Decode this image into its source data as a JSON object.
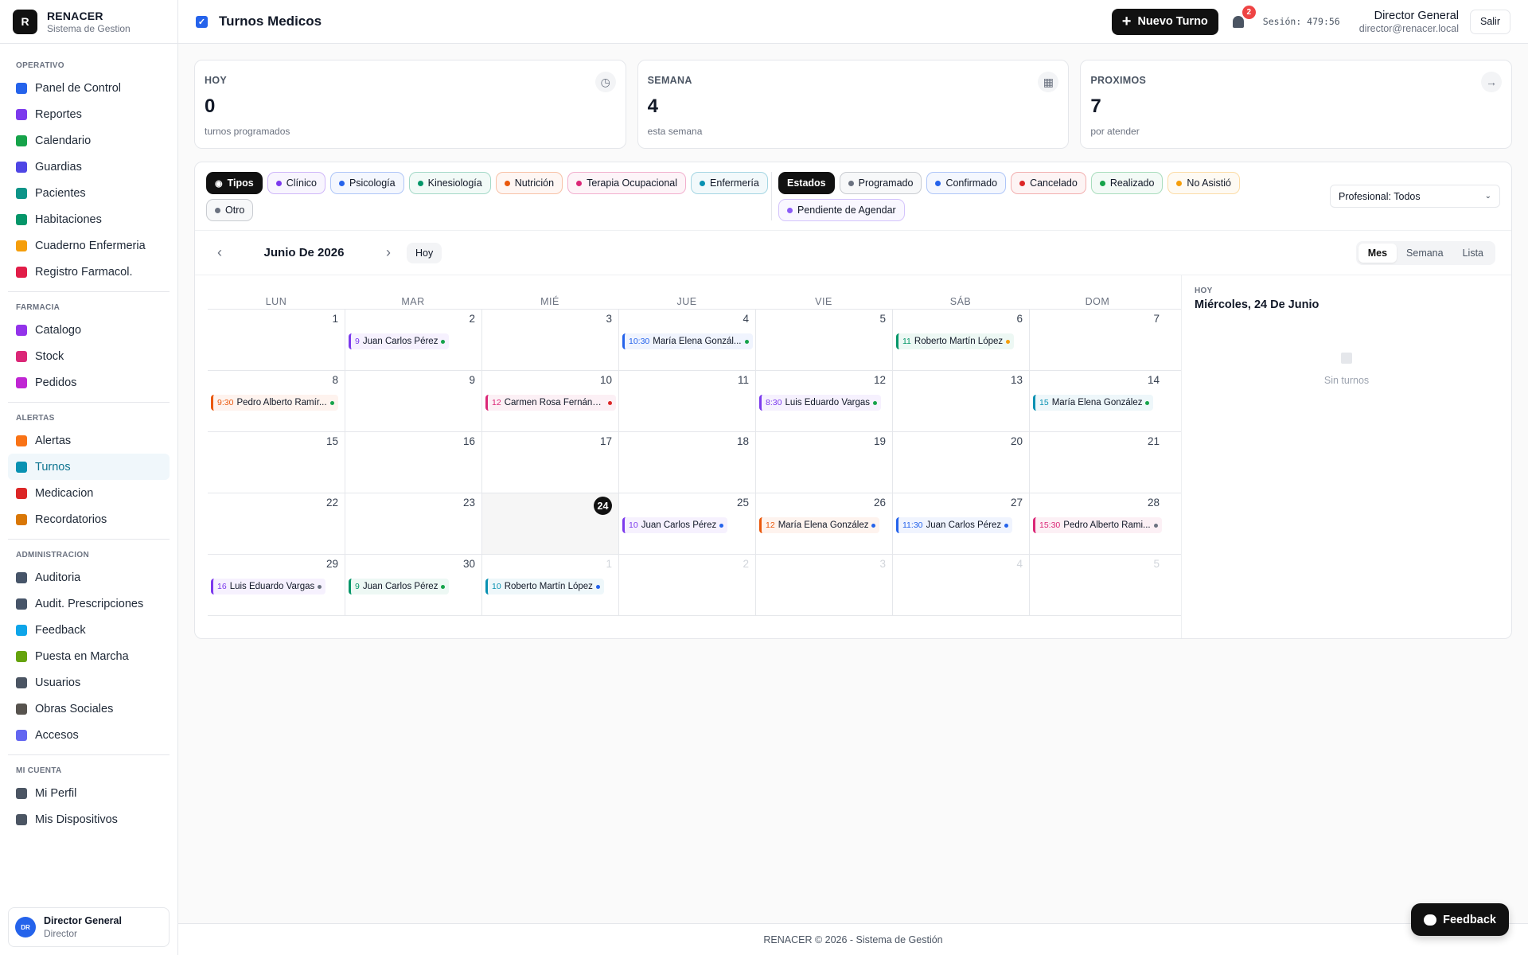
{
  "brand": {
    "logo_letter": "R",
    "title": "RENACER",
    "subtitle": "Sistema de Gestion"
  },
  "sidebar": {
    "sections": [
      {
        "heading": "OPERATIVO",
        "items": [
          {
            "label": "Panel de Control",
            "icon": "chart-line-icon",
            "color": "#2563eb"
          },
          {
            "label": "Reportes",
            "icon": "pie-chart-icon",
            "color": "#7c3aed"
          },
          {
            "label": "Calendario",
            "icon": "calendar-icon",
            "color": "#16a34a"
          },
          {
            "label": "Guardias",
            "icon": "calendar-user-icon",
            "color": "#4f46e5"
          },
          {
            "label": "Pacientes",
            "icon": "users-icon",
            "color": "#0d9488"
          },
          {
            "label": "Habitaciones",
            "icon": "home-icon",
            "color": "#059669"
          },
          {
            "label": "Cuaderno Enfermeria",
            "icon": "book-icon",
            "color": "#f59e0b"
          },
          {
            "label": "Registro Farmacol.",
            "icon": "syringe-icon",
            "color": "#e11d48"
          }
        ]
      },
      {
        "heading": "FARMACIA",
        "items": [
          {
            "label": "Catalogo",
            "icon": "pills-icon",
            "color": "#9333ea"
          },
          {
            "label": "Stock",
            "icon": "boxes-icon",
            "color": "#db2777"
          },
          {
            "label": "Pedidos",
            "icon": "clipboard-icon",
            "color": "#c026d3"
          }
        ]
      },
      {
        "heading": "ALERTAS",
        "items": [
          {
            "label": "Alertas",
            "icon": "bell-icon",
            "color": "#f97316"
          },
          {
            "label": "Turnos",
            "icon": "calendar-check-icon",
            "color": "#0891b2",
            "active": true
          },
          {
            "label": "Medicacion",
            "icon": "medkit-icon",
            "color": "#dc2626"
          },
          {
            "label": "Recordatorios",
            "icon": "list-icon",
            "color": "#d97706"
          }
        ]
      },
      {
        "heading": "ADMINISTRACION",
        "items": [
          {
            "label": "Auditoria",
            "icon": "file-icon",
            "color": "#475569"
          },
          {
            "label": "Audit. Prescripciones",
            "icon": "file-search-icon",
            "color": "#475569"
          },
          {
            "label": "Feedback",
            "icon": "comments-icon",
            "color": "#0ea5e9"
          },
          {
            "label": "Puesta en Marcha",
            "icon": "rocket-icon",
            "color": "#65a30d"
          },
          {
            "label": "Usuarios",
            "icon": "user-cog-icon",
            "color": "#4b5563"
          },
          {
            "label": "Obras Sociales",
            "icon": "building-icon",
            "color": "#57534e"
          },
          {
            "label": "Accesos",
            "icon": "shield-icon",
            "color": "#6366f1"
          }
        ]
      },
      {
        "heading": "MI CUENTA",
        "items": [
          {
            "label": "Mi Perfil",
            "icon": "user-circle-icon",
            "color": "#4b5563"
          },
          {
            "label": "Mis Dispositivos",
            "icon": "desktop-icon",
            "color": "#4b5563"
          }
        ]
      }
    ],
    "user": {
      "initials": "DR",
      "name": "Director General",
      "role": "Director"
    }
  },
  "topbar": {
    "title": "Turnos Medicos",
    "new_button": "Nuevo Turno",
    "notifications_count": "2",
    "session": "Sesión: 479:56",
    "user_name": "Director General",
    "user_email": "director@renacer.local",
    "logout": "Salir"
  },
  "stats": [
    {
      "label": "HOY",
      "value": "0",
      "sub": "turnos programados",
      "icon": "clock-icon",
      "glyph": "◷"
    },
    {
      "label": "SEMANA",
      "value": "4",
      "sub": "esta semana",
      "icon": "calendar-icon",
      "glyph": "▦"
    },
    {
      "label": "PROXIMOS",
      "value": "7",
      "sub": "por atender",
      "icon": "arrow-right-icon",
      "glyph": "→"
    }
  ],
  "filters": {
    "tipos_label": "Tipos",
    "tipos": [
      {
        "label": "Clínico",
        "color": "#7c3aed"
      },
      {
        "label": "Psicología",
        "color": "#2563eb"
      },
      {
        "label": "Kinesiología",
        "color": "#059669"
      },
      {
        "label": "Nutrición",
        "color": "#ea580c"
      },
      {
        "label": "Terapia Ocupacional",
        "color": "#db2777"
      },
      {
        "label": "Enfermería",
        "color": "#0891b2"
      },
      {
        "label": "Otro",
        "color": "#6b7280"
      }
    ],
    "estados_label": "Estados",
    "estados": [
      {
        "label": "Programado",
        "color": "#6b7280"
      },
      {
        "label": "Confirmado",
        "color": "#2563eb"
      },
      {
        "label": "Cancelado",
        "color": "#dc2626"
      },
      {
        "label": "Realizado",
        "color": "#16a34a"
      },
      {
        "label": "No Asistió",
        "color": "#f59e0b"
      },
      {
        "label": "Pendiente de Agendar",
        "color": "#8b5cf6"
      }
    ],
    "profesional": "Profesional: Todos"
  },
  "calendar": {
    "month_label": "Junio De 2026",
    "today_button": "Hoy",
    "views": [
      "Mes",
      "Semana",
      "Lista"
    ],
    "active_view": "Mes",
    "weekdays": [
      "LUN",
      "MAR",
      "MIÉ",
      "JUE",
      "VIE",
      "SÁB",
      "DOM"
    ],
    "today": "24",
    "weeks": [
      [
        {
          "day": "1"
        },
        {
          "day": "2",
          "events": [
            {
              "time": "9",
              "name": "Juan Carlos Pérez",
              "color": "#7c3aed",
              "status": "#16a34a"
            }
          ]
        },
        {
          "day": "3"
        },
        {
          "day": "4",
          "events": [
            {
              "time": "10:30",
              "name": "María Elena Gonzál...",
              "color": "#2563eb",
              "status": "#16a34a"
            }
          ]
        },
        {
          "day": "5"
        },
        {
          "day": "6",
          "events": [
            {
              "time": "11",
              "name": "Roberto Martín López",
              "color": "#059669",
              "status": "#f59e0b"
            }
          ]
        },
        {
          "day": "7"
        }
      ],
      [
        {
          "day": "8",
          "events": [
            {
              "time": "9:30",
              "name": "Pedro Alberto Ramír...",
              "color": "#ea580c",
              "status": "#16a34a"
            }
          ]
        },
        {
          "day": "9"
        },
        {
          "day": "10",
          "events": [
            {
              "time": "12",
              "name": "Carmen Rosa Fernánd...",
              "color": "#db2777",
              "status": "#dc2626"
            }
          ]
        },
        {
          "day": "11"
        },
        {
          "day": "12",
          "events": [
            {
              "time": "8:30",
              "name": "Luis Eduardo Vargas",
              "color": "#7c3aed",
              "status": "#16a34a"
            }
          ]
        },
        {
          "day": "13"
        },
        {
          "day": "14",
          "events": [
            {
              "time": "15",
              "name": "María Elena González",
              "color": "#0891b2",
              "status": "#16a34a"
            }
          ]
        }
      ],
      [
        {
          "day": "15"
        },
        {
          "day": "16"
        },
        {
          "day": "17"
        },
        {
          "day": "18"
        },
        {
          "day": "19"
        },
        {
          "day": "20"
        },
        {
          "day": "21"
        }
      ],
      [
        {
          "day": "22"
        },
        {
          "day": "23"
        },
        {
          "day": "24",
          "today": true
        },
        {
          "day": "25",
          "events": [
            {
              "time": "10",
              "name": "Juan Carlos Pérez",
              "color": "#7c3aed",
              "status": "#2563eb"
            }
          ]
        },
        {
          "day": "26",
          "events": [
            {
              "time": "12",
              "name": "María Elena González",
              "color": "#ea580c",
              "status": "#2563eb"
            }
          ]
        },
        {
          "day": "27",
          "events": [
            {
              "time": "11:30",
              "name": "Juan Carlos Pérez",
              "color": "#2563eb",
              "status": "#2563eb"
            }
          ]
        },
        {
          "day": "28",
          "events": [
            {
              "time": "15:30",
              "name": "Pedro Alberto Rami...",
              "color": "#db2777",
              "status": "#6b7280"
            }
          ]
        }
      ],
      [
        {
          "day": "29",
          "events": [
            {
              "time": "16",
              "name": "Luis Eduardo Vargas",
              "color": "#7c3aed",
              "status": "#6b7280"
            }
          ]
        },
        {
          "day": "30",
          "events": [
            {
              "time": "9",
              "name": "Juan Carlos Pérez",
              "color": "#059669",
              "status": "#16a34a"
            }
          ]
        },
        {
          "day": "1",
          "muted": true,
          "events": [
            {
              "time": "10",
              "name": "Roberto Martín López",
              "color": "#0891b2",
              "status": "#2563eb"
            }
          ]
        },
        {
          "day": "2",
          "muted": true
        },
        {
          "day": "3",
          "muted": true
        },
        {
          "day": "4",
          "muted": true
        },
        {
          "day": "5",
          "muted": true
        }
      ]
    ]
  },
  "side_panel": {
    "label": "HOY",
    "date": "Miércoles, 24 De Junio",
    "empty": "Sin turnos"
  },
  "footer": "RENACER © 2026 - Sistema de Gestión",
  "feedback_button": "Feedback"
}
